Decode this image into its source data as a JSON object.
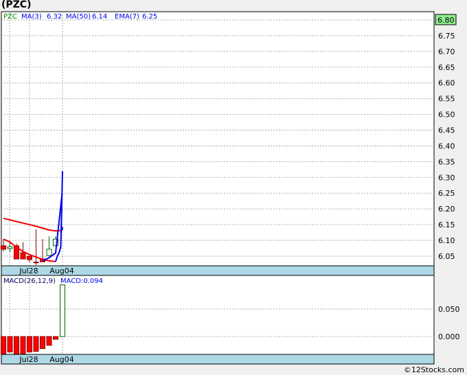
{
  "ticker_title": "(PZC)",
  "credit": "©12Stocks.com",
  "chart_data": [
    {
      "type": "candlestick",
      "legend": {
        "symbol": "PZC",
        "ma3_label": "MA(3)",
        "ma3_value": "6.32",
        "ma50_label": "MA(50)",
        "ma50_value": "6.14",
        "ema7_label": "EMA(7)",
        "ema7_value": "6.25"
      },
      "last_price_label": "6.80",
      "ylim": [
        6.02,
        6.82
      ],
      "yticks": [
        "6.80",
        "6.75",
        "6.70",
        "6.65",
        "6.60",
        "6.55",
        "6.50",
        "6.45",
        "6.40",
        "6.35",
        "6.30",
        "6.25",
        "6.20",
        "6.15",
        "6.10",
        "6.05"
      ],
      "xticks": [
        "Jul28",
        "Aug04"
      ],
      "candles": [
        {
          "o": 6.083,
          "h": 6.104,
          "l": 6.065,
          "c": 6.072
        },
        {
          "o": 6.074,
          "h": 6.094,
          "l": 6.063,
          "c": 6.08
        },
        {
          "o": 6.083,
          "h": 6.09,
          "l": 6.041,
          "c": 6.041
        },
        {
          "o": 6.061,
          "h": 6.094,
          "l": 6.041,
          "c": 6.041
        },
        {
          "o": 6.05,
          "h": 6.05,
          "l": 6.03,
          "c": 6.039
        },
        {
          "o": 6.031,
          "h": 6.135,
          "l": 6.022,
          "c": 6.03
        },
        {
          "o": 6.041,
          "h": 6.104,
          "l": 6.032,
          "c": 6.032
        },
        {
          "o": 6.052,
          "h": 6.113,
          "l": 6.052,
          "c": 6.072
        },
        {
          "o": 6.083,
          "h": 6.113,
          "l": 6.083,
          "c": 6.104
        }
      ],
      "series": [
        {
          "name": "MA(50)",
          "color": "#ee0000",
          "values": [
            6.17,
            6.165,
            6.16,
            6.155,
            6.15,
            6.145,
            6.139,
            6.133,
            6.13,
            6.132,
            null
          ],
          "tail_color": "#0000ee",
          "tail": [
            6.132,
            6.142
          ]
        },
        {
          "name": "MA(3)",
          "color": "#ee0000",
          "values": [
            6.104,
            6.095,
            6.078,
            6.065,
            6.055,
            6.047,
            6.04,
            6.035,
            6.033
          ],
          "tail_color": "#0000ee",
          "tail": [
            6.033,
            6.05,
            6.06,
            6.08,
            6.32
          ]
        },
        {
          "name": "EMA(7)",
          "color": "#0000ee",
          "values": [
            null,
            null,
            null,
            null,
            null,
            null,
            6.035,
            6.045,
            6.06,
            6.25
          ]
        }
      ]
    },
    {
      "type": "bar",
      "title": "MACD(26,12,9)",
      "value_label": "MACD:0.094",
      "ylim": [
        -0.032,
        0.105
      ],
      "yticks": [
        "0.050",
        "0.000"
      ],
      "xticks": [
        "Jul28",
        "Aug04"
      ],
      "values": [
        -0.032,
        -0.028,
        -0.032,
        -0.032,
        -0.028,
        -0.027,
        -0.022,
        -0.016,
        -0.005,
        0.094
      ]
    }
  ]
}
